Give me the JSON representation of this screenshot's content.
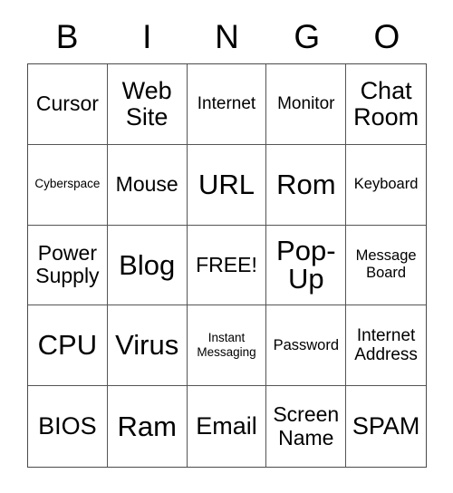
{
  "header": {
    "letters": [
      "B",
      "I",
      "N",
      "G",
      "O"
    ]
  },
  "grid": {
    "columns": 5,
    "rows": 5,
    "border_color": "#4a4a4a",
    "background_color": "#ffffff",
    "text_color": "#000000",
    "cells": [
      {
        "text": "Cursor",
        "size": "l"
      },
      {
        "text": "Web\nSite",
        "size": "xl"
      },
      {
        "text": "Internet",
        "size": "m"
      },
      {
        "text": "Monitor",
        "size": "m"
      },
      {
        "text": "Chat\nRoom",
        "size": "xl"
      },
      {
        "text": "Cyberspace",
        "size": "xs"
      },
      {
        "text": "Mouse",
        "size": "l"
      },
      {
        "text": "URL",
        "size": "xxl"
      },
      {
        "text": "Rom",
        "size": "xxl"
      },
      {
        "text": "Keyboard",
        "size": "s"
      },
      {
        "text": "Power\nSupply",
        "size": "l"
      },
      {
        "text": "Blog",
        "size": "xxl"
      },
      {
        "text": "FREE!",
        "size": "l"
      },
      {
        "text": "Pop-\nUp",
        "size": "xxl"
      },
      {
        "text": "Message\nBoard",
        "size": "s"
      },
      {
        "text": "CPU",
        "size": "xxl"
      },
      {
        "text": "Virus",
        "size": "xxl"
      },
      {
        "text": "Instant\nMessaging",
        "size": "xs"
      },
      {
        "text": "Password",
        "size": "s"
      },
      {
        "text": "Internet\nAddress",
        "size": "m"
      },
      {
        "text": "BIOS",
        "size": "xl"
      },
      {
        "text": "Ram",
        "size": "xxl"
      },
      {
        "text": "Email",
        "size": "xl"
      },
      {
        "text": "Screen\nName",
        "size": "l"
      },
      {
        "text": "SPAM",
        "size": "xl"
      }
    ]
  }
}
